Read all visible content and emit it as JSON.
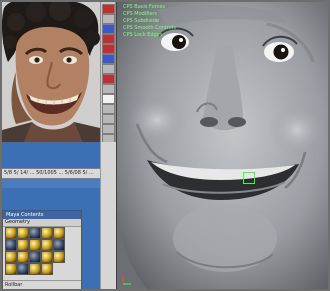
{
  "reference_photo": {
    "icon": "smiling-man-reference-photo"
  },
  "toolbar": {
    "tools": [
      {
        "icon": "select-tool-icon",
        "accent": "#c03030"
      },
      {
        "icon": "lasso-tool-icon",
        "accent": "#b8b8b8"
      },
      {
        "icon": "paint-select-tool-icon",
        "accent": "#3b59c9"
      },
      {
        "icon": "move-tool-icon",
        "accent": "#c03030"
      },
      {
        "icon": "rotate-tool-icon",
        "accent": "#c03030"
      },
      {
        "icon": "scale-tool-icon",
        "accent": "#3b59c9"
      },
      {
        "icon": "manipulator-tool-icon",
        "accent": "#b8b8b8"
      },
      {
        "icon": "soft-mod-tool-icon",
        "accent": "#c03030"
      },
      {
        "icon": "show-manipulator-icon",
        "accent": "#b8b8b8"
      },
      {
        "icon": "last-tool-icon",
        "accent": "#f2f2f2"
      },
      {
        "icon": "single-pane-layout-icon",
        "accent": "#b8b8b8"
      },
      {
        "icon": "four-pane-layout-icon",
        "accent": "#b8b8b8"
      },
      {
        "icon": "outliner-layout-icon",
        "accent": "#b8b8b8"
      },
      {
        "icon": "graph-layout-icon",
        "accent": "#b8b8b8"
      }
    ]
  },
  "status_bar": {
    "text": "5/8 5/ 14/ ... 50/1005 ... 5/6/08 5/ ..."
  },
  "material_window": {
    "title": "Maya Contents",
    "section": "Geometry",
    "footer": "Rollbar"
  },
  "viewport": {
    "hud_lines": [
      "CPS Basis Forces",
      "CPS Modifiers",
      "CPS Subdivide",
      "CPS Smooth Controls",
      "CPS Lock Edges"
    ],
    "hud_color": "#7dff7d",
    "model_icon": "smiling-head-3d-model"
  }
}
